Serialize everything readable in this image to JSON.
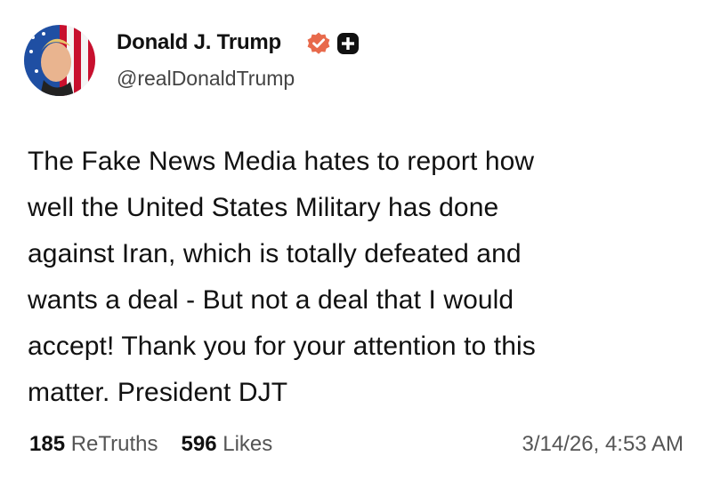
{
  "author": {
    "display_name": "Donald J. Trump",
    "handle": "@realDonaldTrump",
    "verified_badge_color": "#e86a4c"
  },
  "post": {
    "lines": [
      "The Fake News Media hates to report how",
      "well the United States Military has done",
      "against Iran, which is totally defeated and",
      "wants a deal - But not a deal that I would",
      "accept! Thank you for your attention to this",
      "matter. President DJT"
    ]
  },
  "stats": {
    "retruths_count": "185",
    "retruths_label": "ReTruths",
    "likes_count": "596",
    "likes_label": "Likes"
  },
  "timestamp": "3/14/26, 4:53 AM"
}
